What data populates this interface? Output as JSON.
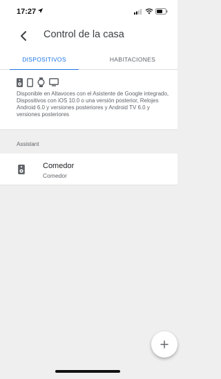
{
  "status_bar": {
    "time": "17:27",
    "icons": [
      "location-arrow-icon",
      "cellular-signal-icon",
      "wifi-icon",
      "battery-icon"
    ]
  },
  "app_bar": {
    "back_icon": "back-arrow-icon",
    "title": "Control de la casa"
  },
  "tabs": [
    {
      "label": "DISPOSITIVOS",
      "selected": true
    },
    {
      "label": "HABITACIONES",
      "selected": false
    }
  ],
  "info": {
    "device_icons": [
      "speaker-icon",
      "phone-icon",
      "watch-icon",
      "tv-icon"
    ],
    "text": "Disponible en Altavoces con el Asistente de Google integrado, Dispositivos con iOS 10.0 o una versión posterior, Relojes Android 6.0 y versiones posteriores y Android TV 6.0 y versiones posteriores"
  },
  "section": {
    "header": "Assistant"
  },
  "devices": [
    {
      "name": "Comedor",
      "room": "Comedor",
      "icon": "speaker-icon"
    }
  ],
  "fab": {
    "icon": "plus-icon"
  },
  "colors": {
    "accent": "#1a73e8",
    "background": "#efefef",
    "surface": "#ffffff",
    "secondary_text": "#5f6368"
  }
}
